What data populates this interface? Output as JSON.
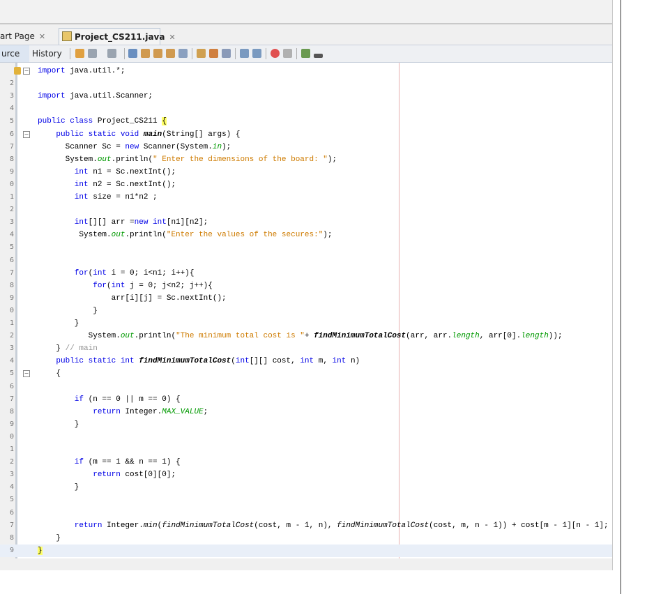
{
  "tabs": [
    {
      "label": "art Page",
      "active": false
    },
    {
      "label": "Project_CS211.java",
      "active": true
    }
  ],
  "toolbar": {
    "source_label": "urce",
    "history_label": "History"
  },
  "colors": {
    "keyword": "#0000e6",
    "string": "#ce7b00",
    "field": "#009900",
    "comment": "#969696",
    "current_line": "#e9eff8",
    "brace_highlight": "#ffff66"
  },
  "editor": {
    "line_numbers": [
      "",
      "2",
      "3",
      "4",
      "5",
      "6",
      "7",
      "8",
      "9",
      "0",
      "1",
      "2",
      "3",
      "4",
      "5",
      "6",
      "7",
      "8",
      "9",
      "0",
      "1",
      "2",
      "3",
      "4",
      "5",
      "6",
      "7",
      "8",
      "9",
      "0",
      "1",
      "2",
      "3",
      "4",
      "5",
      "6",
      "7",
      "8",
      "9"
    ],
    "lines": [
      [
        [
          "import",
          "k"
        ],
        [
          " java.util.*;",
          ""
        ]
      ],
      [],
      [
        [
          "import",
          "k"
        ],
        [
          " java.util.Scanner;",
          ""
        ]
      ],
      [],
      [
        [
          "public class",
          "k"
        ],
        [
          " Project_CS211 ",
          ""
        ],
        [
          "{",
          "hl"
        ]
      ],
      [
        [
          "    public static void",
          "k"
        ],
        [
          " ",
          ""
        ],
        [
          "main",
          "m"
        ],
        [
          "(String[] args) {",
          ""
        ]
      ],
      [
        [
          "      Scanner Sc = ",
          ""
        ],
        [
          "new",
          "k"
        ],
        [
          " Scanner(System.",
          ""
        ],
        [
          "in",
          "f"
        ],
        [
          ");",
          ""
        ]
      ],
      [
        [
          "      System.",
          ""
        ],
        [
          "out",
          "f"
        ],
        [
          ".println(",
          ""
        ],
        [
          "\" Enter the dimensions of the board: \"",
          "s"
        ],
        [
          ");",
          ""
        ]
      ],
      [
        [
          "        int",
          "k"
        ],
        [
          " n1 = Sc.nextInt();",
          ""
        ]
      ],
      [
        [
          "        int",
          "k"
        ],
        [
          " n2 = Sc.nextInt();",
          ""
        ]
      ],
      [
        [
          "        int",
          "k"
        ],
        [
          " size = n1*n2 ;",
          ""
        ]
      ],
      [],
      [
        [
          "        int",
          "k"
        ],
        [
          "[][] arr =",
          ""
        ],
        [
          "new int",
          "k"
        ],
        [
          "[n1][n2];",
          ""
        ]
      ],
      [
        [
          "         System.",
          ""
        ],
        [
          "out",
          "f"
        ],
        [
          ".println(",
          ""
        ],
        [
          "\"Enter the values of the secures:\"",
          "s"
        ],
        [
          ");",
          ""
        ]
      ],
      [],
      [],
      [
        [
          "        for",
          "k"
        ],
        [
          "(",
          ""
        ],
        [
          "int",
          "k"
        ],
        [
          " i = 0; i<n1; i++){",
          ""
        ]
      ],
      [
        [
          "            for",
          "k"
        ],
        [
          "(",
          ""
        ],
        [
          "int",
          "k"
        ],
        [
          " j = 0; j<n2; j++){",
          ""
        ]
      ],
      [
        [
          "                arr[i][j] = Sc.nextInt();",
          ""
        ]
      ],
      [
        [
          "            }",
          ""
        ]
      ],
      [
        [
          "        }",
          ""
        ]
      ],
      [
        [
          "           System.",
          ""
        ],
        [
          "out",
          "f"
        ],
        [
          ".println(",
          ""
        ],
        [
          "\"The minimum total cost is \"",
          "s"
        ],
        [
          "+ ",
          ""
        ],
        [
          "findMinimumTotalCost",
          "m"
        ],
        [
          "(arr, arr.",
          ""
        ],
        [
          "length",
          "f"
        ],
        [
          ", arr[0].",
          ""
        ],
        [
          "length",
          "f"
        ],
        [
          "));",
          ""
        ]
      ],
      [
        [
          "    } ",
          ""
        ],
        [
          "// main",
          "c"
        ]
      ],
      [
        [
          "    public static int",
          "k"
        ],
        [
          " ",
          ""
        ],
        [
          "findMinimumTotalCost",
          "m"
        ],
        [
          "(",
          ""
        ],
        [
          "int",
          "k"
        ],
        [
          "[][] cost, ",
          ""
        ],
        [
          "int",
          "k"
        ],
        [
          " m, ",
          ""
        ],
        [
          "int",
          "k"
        ],
        [
          " n)",
          ""
        ]
      ],
      [
        [
          "    {",
          ""
        ]
      ],
      [],
      [
        [
          "        if",
          "k"
        ],
        [
          " (n == 0 || m == 0) {",
          ""
        ]
      ],
      [
        [
          "            return",
          "k"
        ],
        [
          " Integer.",
          ""
        ],
        [
          "MAX_VALUE",
          "f"
        ],
        [
          ";",
          ""
        ]
      ],
      [
        [
          "        }",
          ""
        ]
      ],
      [],
      [],
      [
        [
          "        if",
          "k"
        ],
        [
          " (m == 1 && n == 1) {",
          ""
        ]
      ],
      [
        [
          "            return",
          "k"
        ],
        [
          " cost[0][0];",
          ""
        ]
      ],
      [
        [
          "        }",
          ""
        ]
      ],
      [],
      [],
      [
        [
          "        return",
          "k"
        ],
        [
          " Integer.",
          ""
        ],
        [
          "min",
          "mi"
        ],
        [
          "(",
          ""
        ],
        [
          "findMinimumTotalCost",
          "mi"
        ],
        [
          "(cost, m - 1, n), ",
          ""
        ],
        [
          "findMinimumTotalCost",
          "mi"
        ],
        [
          "(cost, m, n - 1)) + cost[m - 1][n - 1];",
          ""
        ]
      ],
      [
        [
          "    }",
          ""
        ]
      ],
      [
        [
          "}",
          "hl"
        ]
      ]
    ]
  }
}
